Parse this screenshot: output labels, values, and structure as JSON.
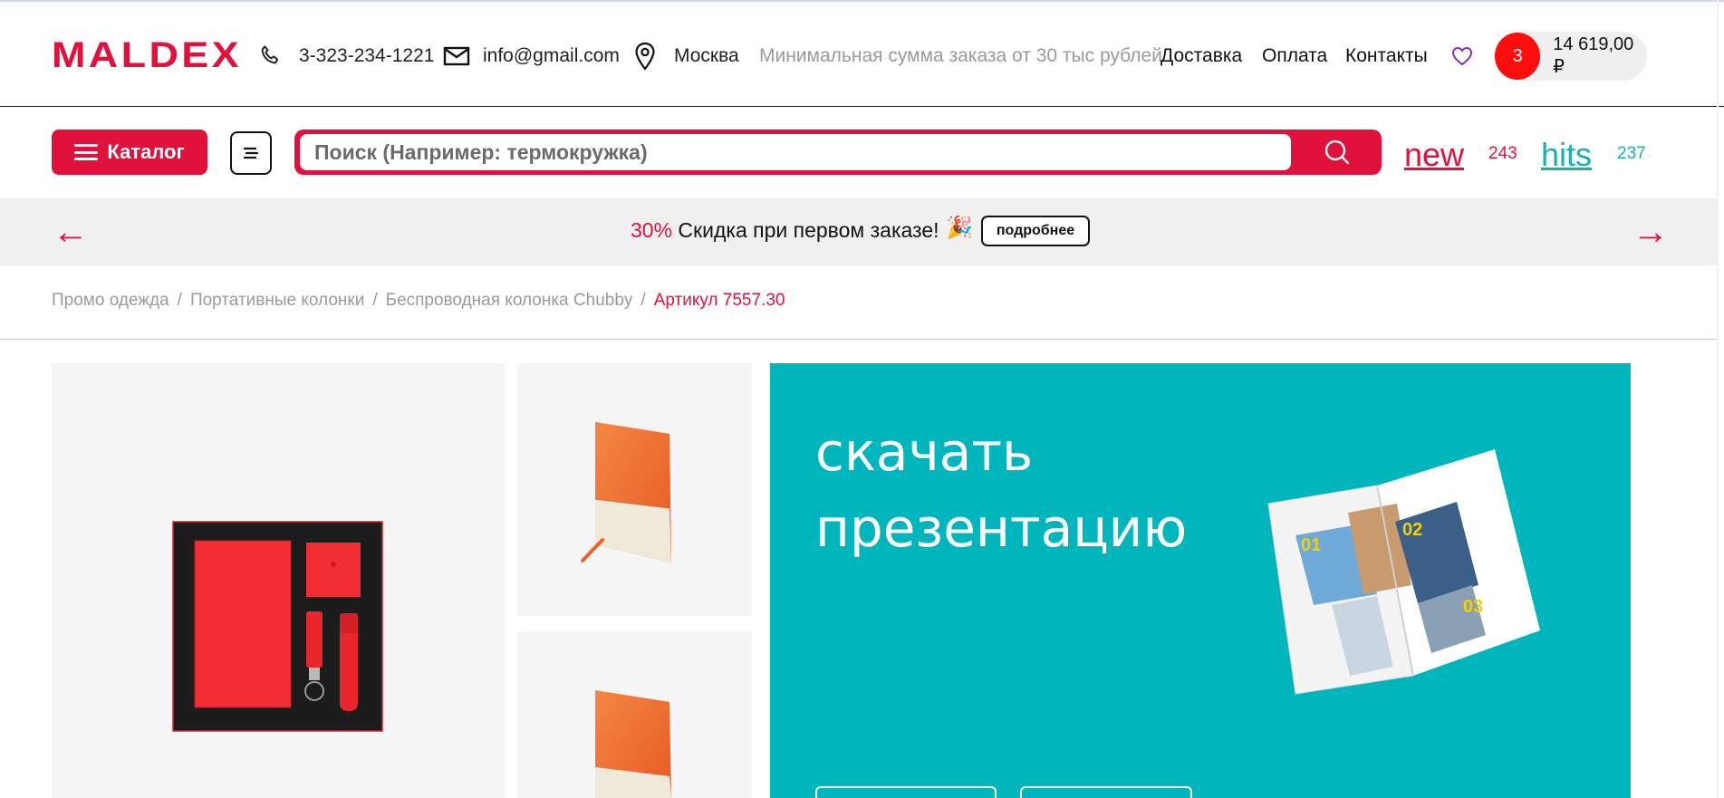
{
  "header": {
    "logo_text": "MALDEX",
    "phone": "3-323-234-1221",
    "email": "info@gmail.com",
    "city": "Москва",
    "min_order": "Минимальная сумма заказа от 30 тыс рублей",
    "nav": {
      "delivery": "Доставка",
      "payment": "Оплата",
      "contacts": "Контакты"
    },
    "cart": {
      "count": "3",
      "sum": "14 619,00 ₽"
    }
  },
  "search_row": {
    "catalog_label": "Каталог",
    "search_placeholder": "Поиск (Например: термокружка)",
    "new_label": "new",
    "new_count": "243",
    "hits_label": "hits",
    "hits_count": "237"
  },
  "promo": {
    "percent": "30%",
    "text": " Скидка при первом заказе! ",
    "more_label": "подробнее",
    "prev_arrow": "←",
    "next_arrow": "→",
    "emoji": "🎉"
  },
  "breadcrumb": {
    "items": [
      "Промо одежда",
      "Портативные колонки",
      "Беспроводная колонка Chubby"
    ],
    "current": "Артикул 7557.30",
    "separator": "/"
  },
  "banner": {
    "title": "скачать презентацию",
    "magazine_numbers": [
      "01",
      "02",
      "03"
    ]
  },
  "colors": {
    "brand_red": "#e0123c",
    "teal": "#00b5bb",
    "hits_teal": "#19b0b0"
  }
}
